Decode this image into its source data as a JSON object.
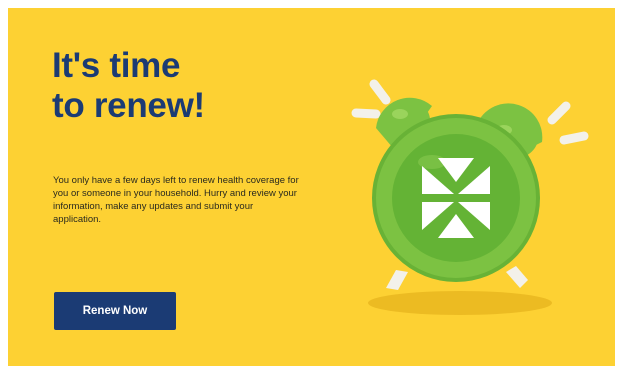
{
  "banner": {
    "headline_line1": "It's time",
    "headline_line2": "to renew!",
    "body": "You only have a few days left to renew health coverage for you or someone in your household. Hurry and review your information, make any updates and submit your application.",
    "cta_label": "Renew Now"
  },
  "colors": {
    "background": "#fdd133",
    "headline": "#1b3b74",
    "button": "#1b3b74",
    "clock_body": "#7cc242",
    "clock_face": "#64b335"
  },
  "icons": {
    "illustration": "alarm-clock-icon"
  }
}
